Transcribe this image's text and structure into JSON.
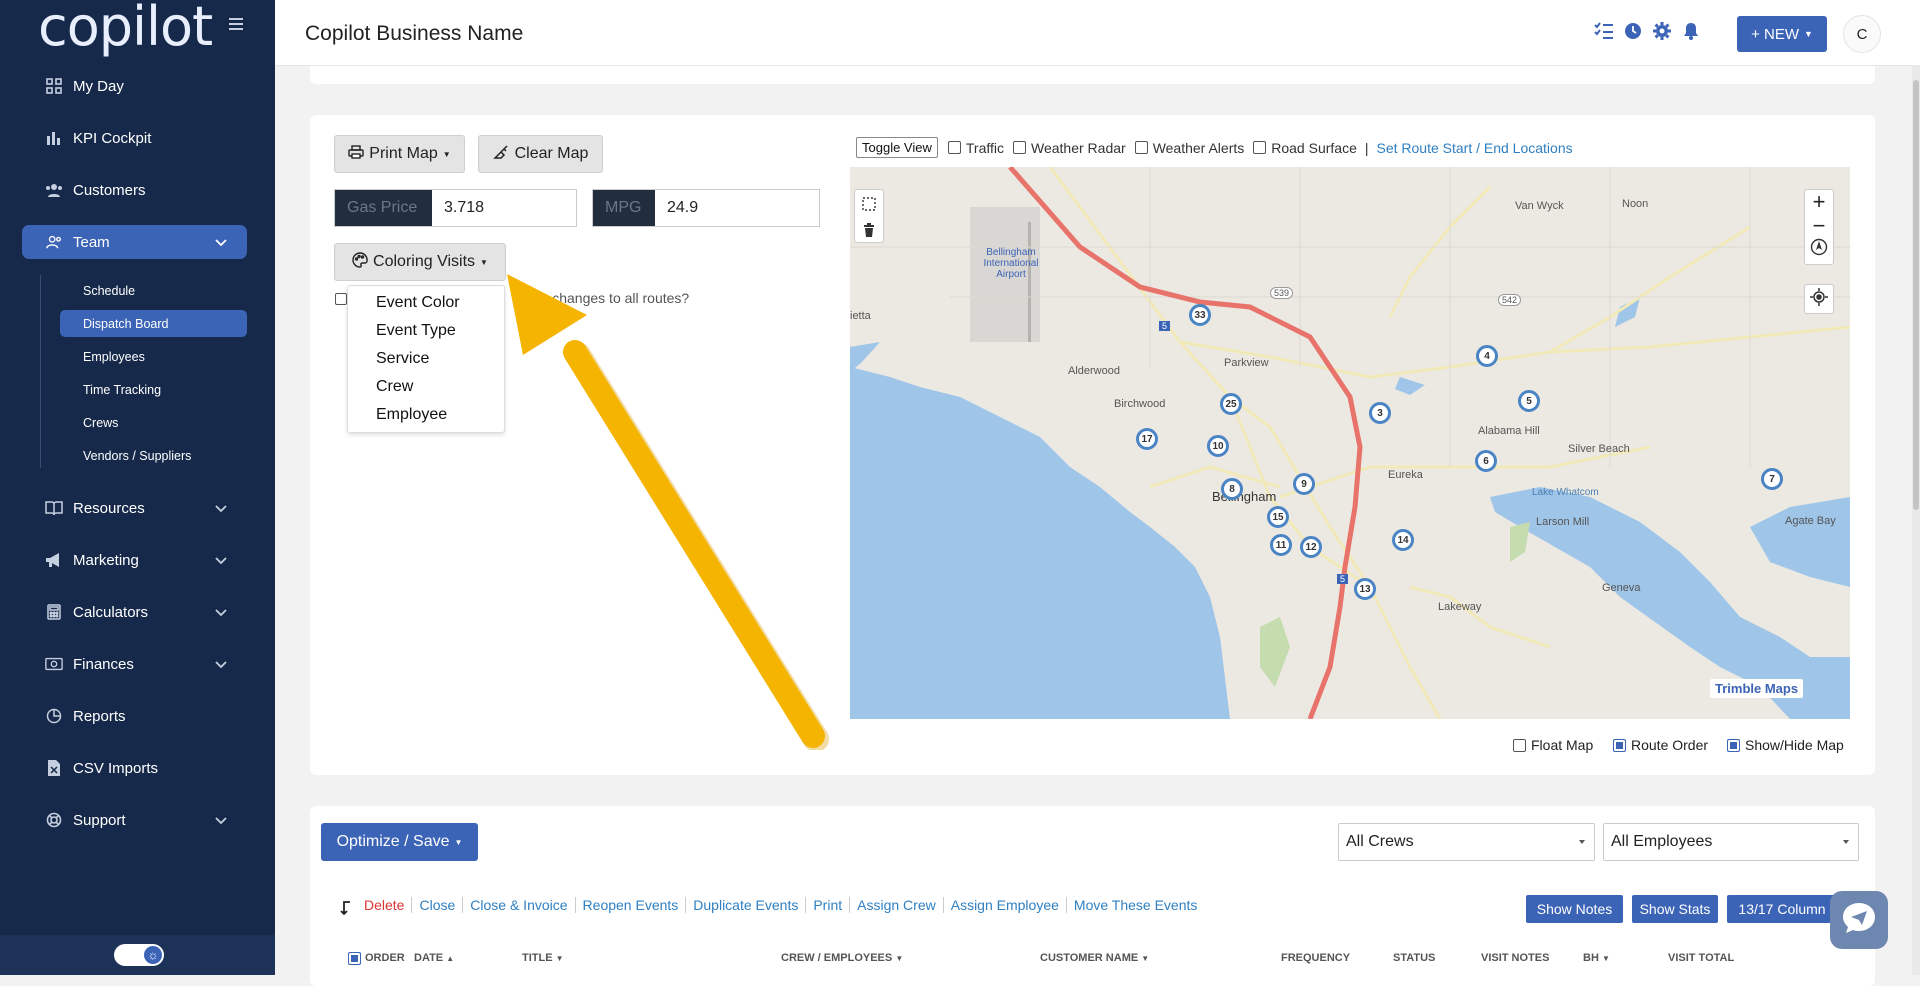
{
  "sidebar": {
    "logo": "copilot",
    "items": [
      {
        "label": "My Day",
        "icon": "grid-icon"
      },
      {
        "label": "KPI Cockpit",
        "icon": "bar-chart-icon"
      },
      {
        "label": "Customers",
        "icon": "users-icon"
      },
      {
        "label": "Team",
        "icon": "team-icon",
        "active": true
      },
      {
        "label": "Resources",
        "icon": "book-icon"
      },
      {
        "label": "Marketing",
        "icon": "megaphone-icon"
      },
      {
        "label": "Calculators",
        "icon": "calculator-icon"
      },
      {
        "label": "Finances",
        "icon": "money-icon"
      },
      {
        "label": "Reports",
        "icon": "pie-chart-icon"
      },
      {
        "label": "CSV Imports",
        "icon": "csv-icon"
      },
      {
        "label": "Support",
        "icon": "lifebuoy-icon"
      }
    ],
    "team_sub": [
      "Schedule",
      "Dispatch Board",
      "Employees",
      "Time Tracking",
      "Crews",
      "Vendors / Suppliers"
    ]
  },
  "topbar": {
    "business_name": "Copilot Business Name",
    "new_label": "+ NEW",
    "avatar_initial": "C"
  },
  "controls": {
    "print_map": "Print Map",
    "clear_map": "Clear Map",
    "gas_label": "Gas Price",
    "gas_value": "3.718",
    "mpg_label": "MPG",
    "mpg_value": "24.9",
    "coloring": "Coloring Visits",
    "apply_text": "olor changes to all routes?",
    "menu": [
      "Event Color",
      "Event Type",
      "Service",
      "Crew",
      "Employee"
    ]
  },
  "map_options": {
    "toggle_view": "Toggle View",
    "traffic": "Traffic",
    "weather_radar": "Weather Radar",
    "weather_alerts": "Weather Alerts",
    "road_surface": "Road Surface",
    "separator": "|",
    "route_link": "Set Route Start / End Locations",
    "float_map": "Float Map",
    "route_order": "Route Order",
    "show_hide": "Show/Hide Map",
    "brand": "Trimble Maps"
  },
  "map_labels": {
    "airport": "Bellingham International Airport",
    "bellingham": "Bellingham",
    "alderwood": "Alderwood",
    "birchwood": "Birchwood",
    "parkview": "Parkview",
    "eureka": "Eureka",
    "alabama_hill": "Alabama Hill",
    "silver_beach": "Silver Beach",
    "lake_whatcom": "Lake Whatcom",
    "larson_mill": "Larson Mill",
    "geneva": "Geneva",
    "lakeway": "Lakeway",
    "van_wyck": "Van Wyck",
    "noon": "Noon",
    "agate_bay": "Agate Bay",
    "marietta": "ietta",
    "r539": "539",
    "r542": "542",
    "i5": "5"
  },
  "pins": [
    "33",
    "25",
    "3",
    "4",
    "5",
    "17",
    "10",
    "8",
    "9",
    "15",
    "11",
    "12",
    "14",
    "6",
    "7",
    "13"
  ],
  "table_controls": {
    "optimize": "Optimize / Save",
    "all_crews": "All Crews",
    "all_employees": "All Employees",
    "actions": [
      "Delete",
      "Close",
      "Close & Invoice",
      "Reopen Events",
      "Duplicate Events",
      "Print",
      "Assign Crew",
      "Assign Employee",
      "Move These Events"
    ],
    "show_notes": "Show Notes",
    "show_stats": "Show Stats",
    "columns": "13/17 Column",
    "headers": [
      "ORDER",
      "DATE",
      "TITLE",
      "CREW / EMPLOYEES",
      "CUSTOMER NAME",
      "FREQUENCY",
      "STATUS",
      "VISIT NOTES",
      "BH",
      "VISIT TOTAL"
    ]
  },
  "colors": {
    "accent": "#3b63b6",
    "sidebar": "#16294a",
    "arrow": "#f5b400"
  }
}
